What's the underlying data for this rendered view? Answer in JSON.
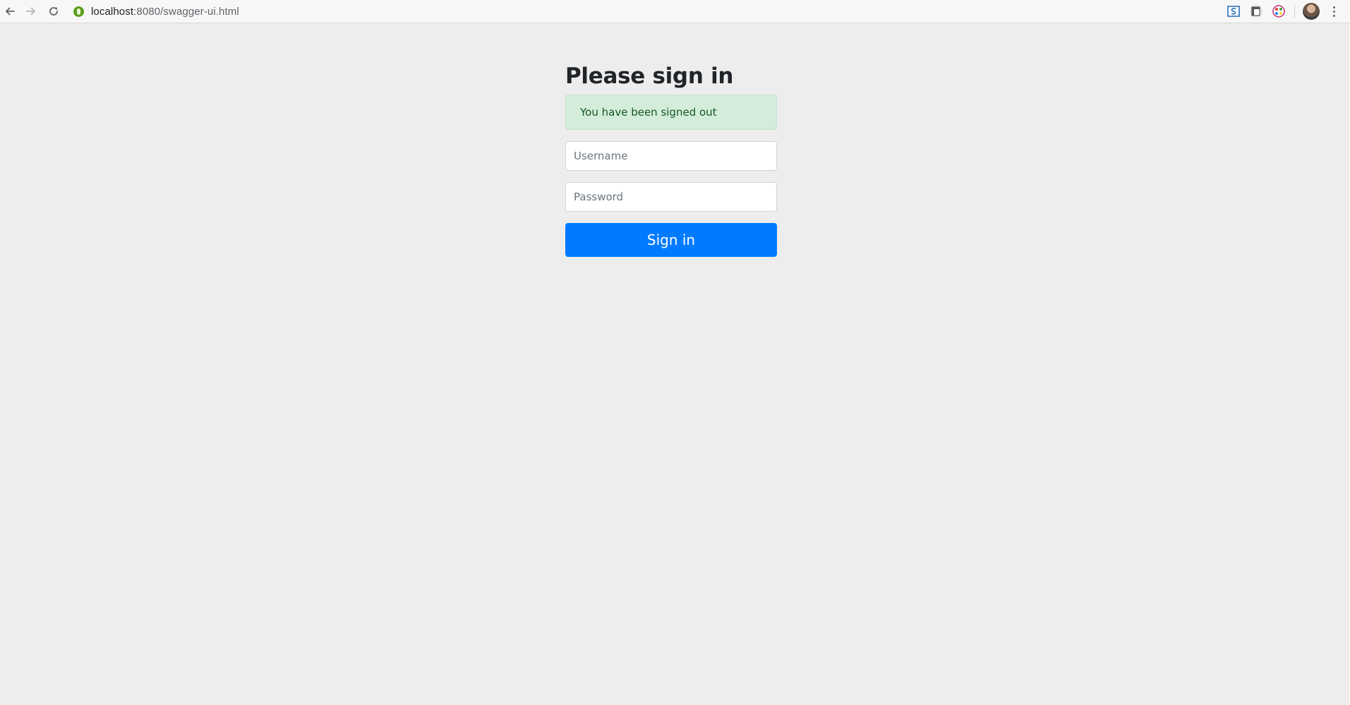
{
  "browser": {
    "url_host": "localhost",
    "url_path": ":8080/swagger-ui.html",
    "icons": {
      "back": "arrow-left-icon",
      "forward": "arrow-right-icon",
      "reload": "reload-icon",
      "secure": "secure-icon",
      "extension_1": "extension-icon",
      "extension_2": "extension-icon",
      "extension_3": "extension-icon",
      "menu": "kebab-menu-icon"
    }
  },
  "login": {
    "heading": "Please sign in",
    "alert": "You have been signed out",
    "username": {
      "value": "",
      "placeholder": "Username"
    },
    "password": {
      "value": "",
      "placeholder": "Password"
    },
    "submit_label": "Sign in"
  },
  "colors": {
    "page_background": "#ededed",
    "alert_background": "#d4edda",
    "alert_text": "#155724",
    "primary_button": "#007bff",
    "heading_text": "#212529"
  }
}
